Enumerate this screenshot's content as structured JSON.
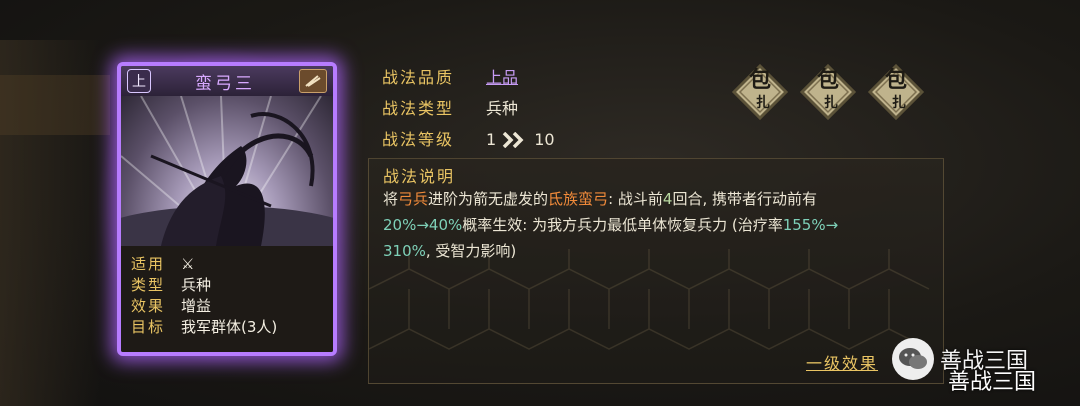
{
  "card": {
    "grade": "上",
    "name": "蛮弓三",
    "info": [
      {
        "key": "适用",
        "value": "⚔"
      },
      {
        "key": "类型",
        "value": "兵种"
      },
      {
        "key": "效果",
        "value": "增益"
      },
      {
        "key": "目标",
        "value": "我军群体(3人)"
      }
    ]
  },
  "stats": {
    "quality_label": "战法品质",
    "quality_value": "上品",
    "type_label": "战法类型",
    "type_value": "兵种",
    "level_label": "战法等级",
    "level_from": "1",
    "level_to": "10"
  },
  "seals": [
    {
      "main": "包",
      "sub": "扎"
    },
    {
      "main": "包",
      "sub": "扎"
    },
    {
      "main": "包",
      "sub": "扎"
    }
  ],
  "description": {
    "title": "战法说明",
    "line1_a": "将",
    "line1_b": "弓兵",
    "line1_c": "进阶为箭无虚发的",
    "line1_d": "氐族蛮弓",
    "line1_e": ": 战斗前",
    "line1_f": "4",
    "line1_g": "回合, 携带者行动前有",
    "line2_a": "20%→40%",
    "line2_b": "概率生效: 为我方兵力最低单体恢复兵力 (治疗率",
    "line2_c": "155%→",
    "line3_a": "310%",
    "line3_b": ", 受智力影响)"
  },
  "effect_link": "一级效果",
  "watermark": {
    "text": "善战三国",
    "text2": "善战三国"
  },
  "colors": {
    "accent_gold": "#e9c463",
    "card_glow": "#b77cff",
    "highlight_orange": "#f08a3a",
    "highlight_green": "#7ed0b8"
  }
}
